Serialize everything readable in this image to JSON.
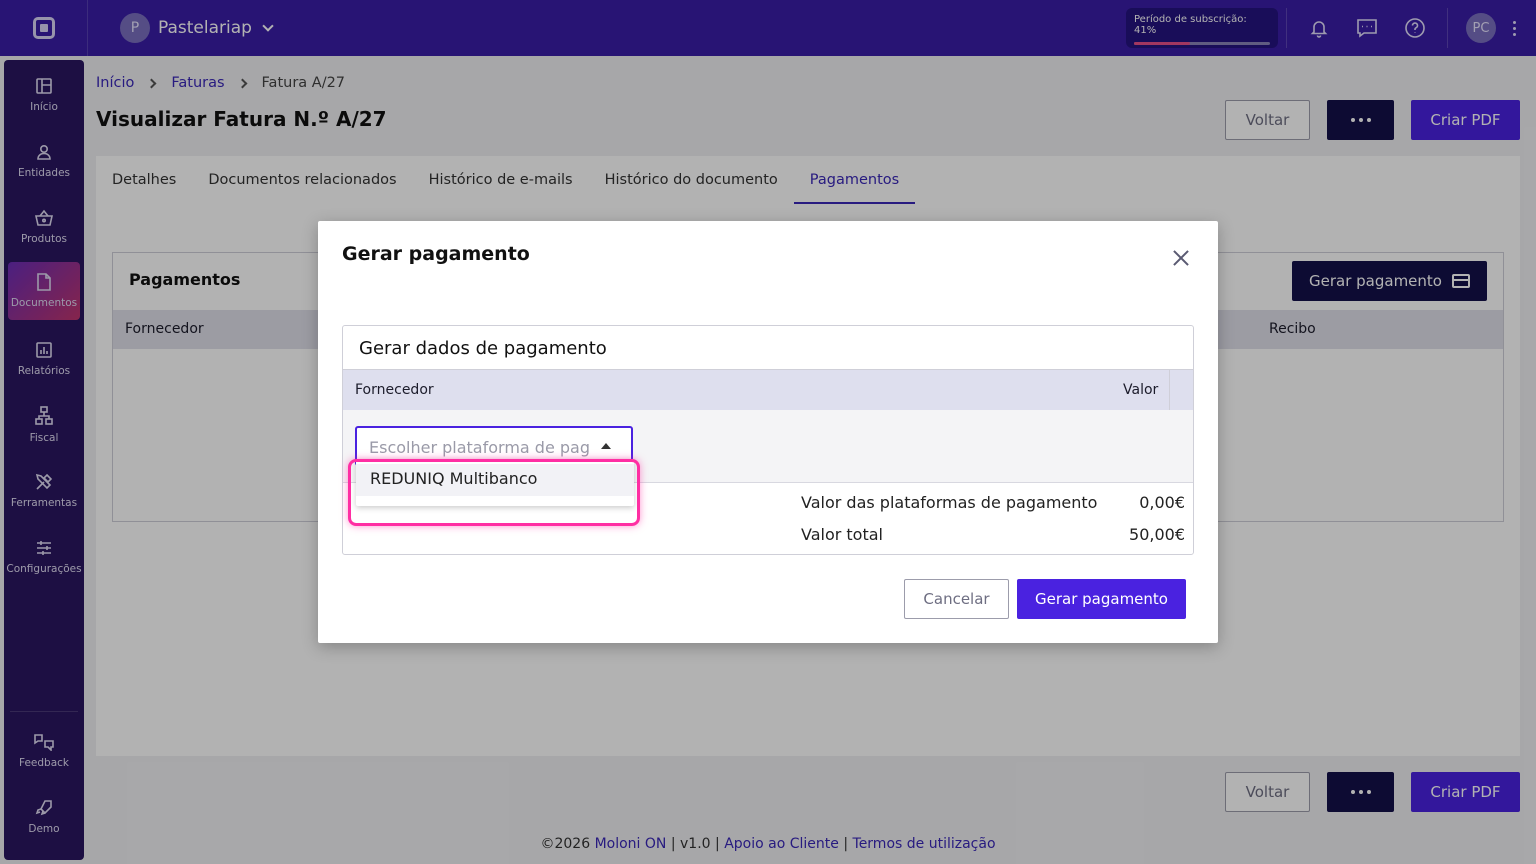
{
  "topbar": {
    "company_initial": "P",
    "company_name": "Pastelariap",
    "subscription_text": "Período de subscrição: 41%",
    "subscription_progress": 0.41,
    "user_initials": "PC"
  },
  "sidebar": {
    "items": [
      {
        "label": "Início",
        "icon": "dashboard-icon"
      },
      {
        "label": "Entidades",
        "icon": "user-icon"
      },
      {
        "label": "Produtos",
        "icon": "basket-icon"
      },
      {
        "label": "Documentos",
        "icon": "document-icon"
      },
      {
        "label": "Relatórios",
        "icon": "report-icon"
      },
      {
        "label": "Fiscal",
        "icon": "fiscal-icon"
      },
      {
        "label": "Ferramentas",
        "icon": "tools-icon"
      },
      {
        "label": "Configurações",
        "icon": "sliders-icon"
      },
      {
        "label": "Feedback",
        "icon": "feedback-icon"
      },
      {
        "label": "Demo",
        "icon": "rocket-icon"
      }
    ],
    "active_index": 3
  },
  "breadcrumb": [
    "Início",
    "Faturas",
    "Fatura A/27"
  ],
  "page": {
    "title": "Visualizar Fatura N.º A/27",
    "back_label": "Voltar",
    "pdf_label": "Criar PDF"
  },
  "tabs": [
    "Detalhes",
    "Documentos relacionados",
    "Histórico de e-mails",
    "Histórico do documento",
    "Pagamentos"
  ],
  "payments": {
    "title": "Pagamentos",
    "generate_label": "Gerar pagamento",
    "col_supplier": "Fornecedor",
    "col_receipt": "Recibo"
  },
  "modal": {
    "title": "Gerar pagamento",
    "section_title": "Gerar dados de pagamento",
    "col_supplier": "Fornecedor",
    "col_value": "Valor",
    "select_placeholder": "Escolher plataforma de pagamento",
    "dropdown_option": "REDUNIQ Multibanco",
    "platforms_label": "Valor das plataformas de pagamento",
    "platforms_value": "0,00€",
    "total_label": "Valor total",
    "total_value": "50,00€",
    "cancel_label": "Cancelar",
    "confirm_label": "Gerar pagamento"
  },
  "footer": {
    "copyright": "©2026",
    "brand": "Moloni ON",
    "version": "v1.0",
    "support": "Apoio ao Cliente",
    "terms": "Termos de utilização"
  },
  "colors": {
    "topbar": "#3a1ea6",
    "sidebar": "#2a1660",
    "primary": "#4a22e0",
    "dark_button": "#13104a",
    "highlight": "#ff2ea3"
  }
}
